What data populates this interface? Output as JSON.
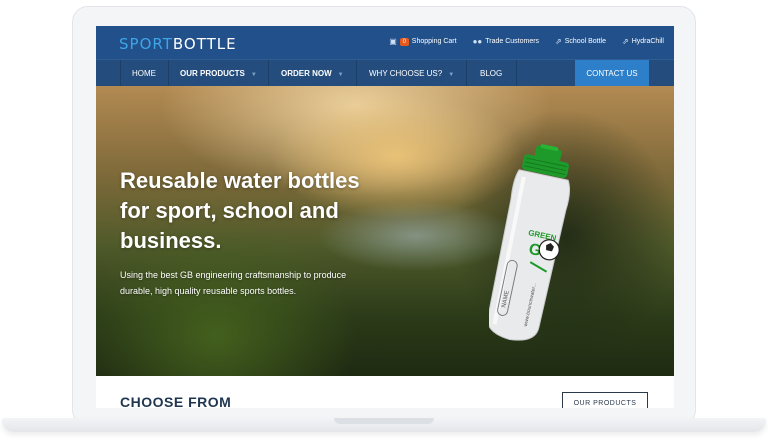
{
  "logo": {
    "part1": "SPORT",
    "part2": "BOTTLE"
  },
  "util_links": [
    {
      "icon": "basket-icon",
      "glyph": "🛒",
      "badge": "0",
      "label": "Shopping Cart"
    },
    {
      "icon": "users-icon",
      "glyph": "👥",
      "label": "Trade Customers"
    },
    {
      "icon": "external-link-icon",
      "glyph": "⇱",
      "label": "School Bottle"
    },
    {
      "icon": "external-link-icon",
      "glyph": "⇱",
      "label": "HydraChill"
    }
  ],
  "nav": {
    "home": "HOME",
    "our_products": "OUR PRODUCTS",
    "order_now": "ORDER NOW",
    "why_choose": "WHY CHOOSE US?",
    "blog": "BLOG",
    "contact": "CONTACT US"
  },
  "hero": {
    "title": "Reusable water bottles for sport, school and business.",
    "subtitle": "Using the best GB engineering craftsmanship to produce durable, high quality reusable sports bottles.",
    "bottle_text_brand": "GREEN",
    "bottle_text_g": "G",
    "bottle_text_name": "NAME",
    "bottle_url": "www.bouncewater..."
  },
  "choose": {
    "heading": "CHOOSE FROM",
    "button": "OUR PRODUCTS"
  },
  "colors": {
    "topbar": "#21508a",
    "nav": "#244d7d",
    "accent": "#2d7fc9",
    "cap": "#1e9a2a"
  }
}
